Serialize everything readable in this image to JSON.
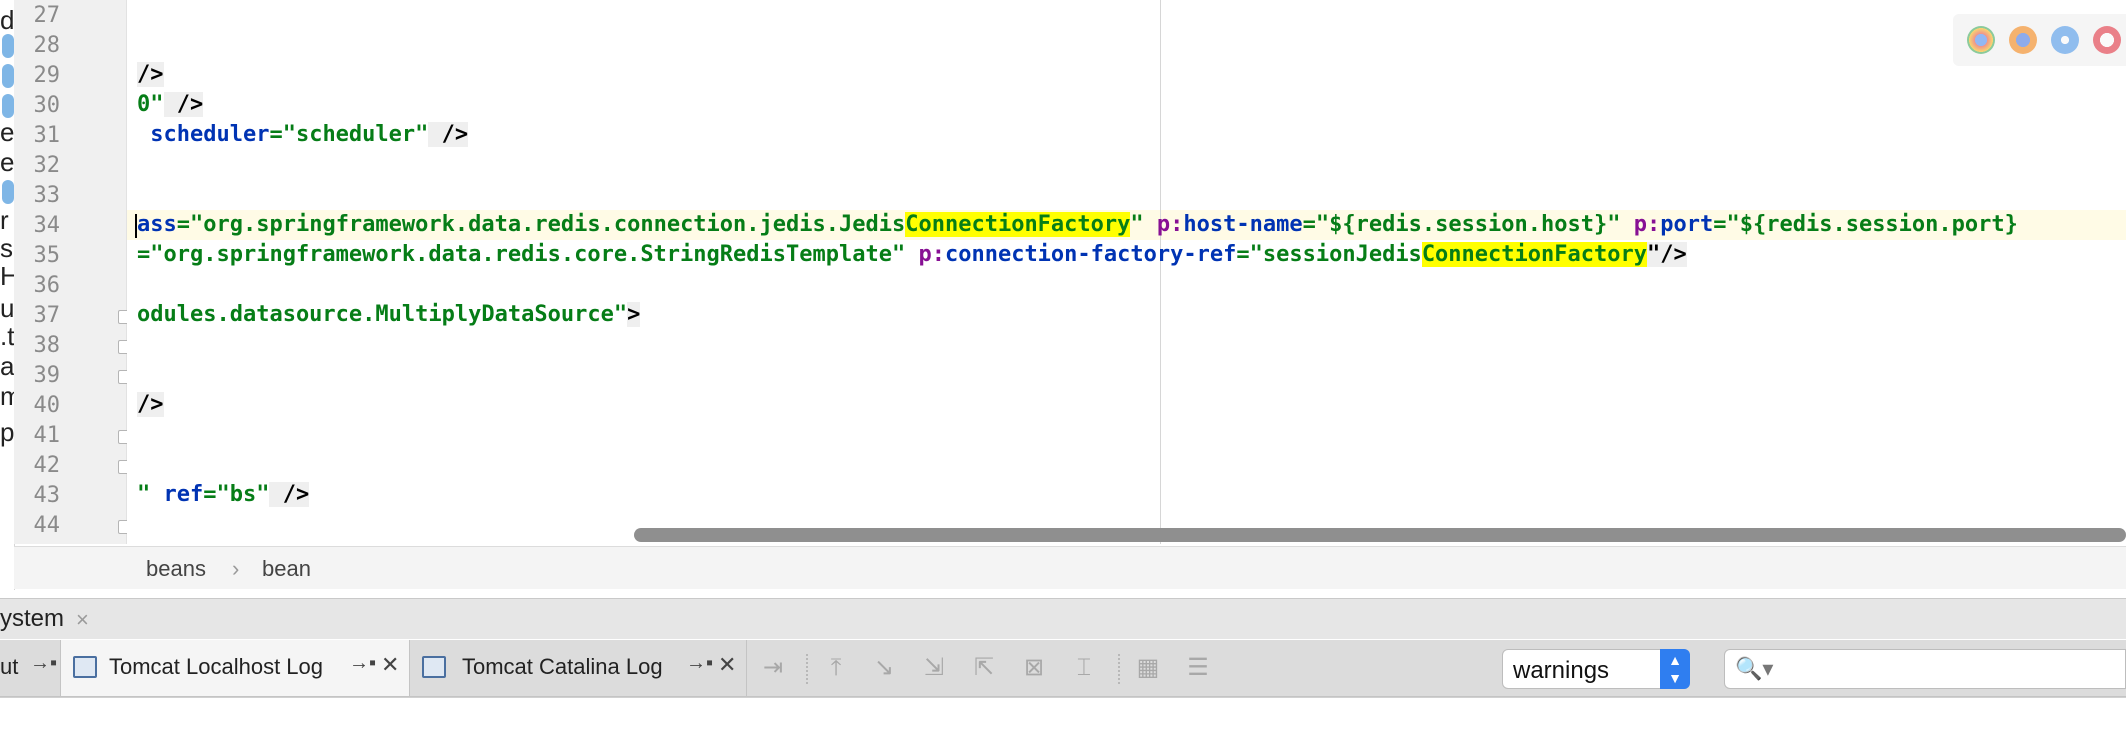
{
  "left_tree": {
    "stubs": [
      "d",
      "e",
      "e",
      "r",
      "s",
      "H",
      "ur",
      ".t",
      "at",
      "m",
      "p"
    ]
  },
  "editor": {
    "line_numbers": [
      "27",
      "28",
      "29",
      "30",
      "31",
      "32",
      "33",
      "34",
      "35",
      "36",
      "37",
      "38",
      "39",
      "40",
      "41",
      "42",
      "43",
      "44"
    ],
    "lines": {
      "l29": "/>",
      "l30_a": "0\"",
      "l30_b": " />",
      "l31_attr": " scheduler",
      "l31_eq": "=",
      "l31_val": "\"scheduler\"",
      "l31_end": " />",
      "l34_attr": "ass",
      "l34_val1": "=\"org.springframework.data.redis.connection.jedis.Jedis",
      "l34_hl": "ConnectionFactory",
      "l34_val1b": "\"",
      "l34_ns1": " p:",
      "l34_attr2": "host-name",
      "l34_val2": "=\"${redis.session.host}\"",
      "l34_ns2": " p:",
      "l34_attr3": "port",
      "l34_val3": "=\"${redis.session.port}",
      "l35_val1": "=\"org.springframework.data.redis.core.StringRedisTemplate\"",
      "l35_ns": " p:",
      "l35_attr": "connection-factory-ref",
      "l35_val2": "=\"sessionJedis",
      "l35_hl": "ConnectionFactory",
      "l35_end": "\"/>",
      "l37_val": "odules.datasource.MultiplyDataSource\"",
      "l37_end": ">",
      "l40": "/>",
      "l43_val": "\"",
      "l43_attr": " ref",
      "l43_val2": "=\"bs\"",
      "l43_end": " />"
    }
  },
  "breadcrumb": [
    "beans",
    "›",
    "bean"
  ],
  "tool_window": {
    "title": "ystem",
    "close": "×"
  },
  "tabs": [
    {
      "label": "ut",
      "pin": "→▪",
      "close": ""
    },
    {
      "label": "Tomcat Localhost Log",
      "pin": "→▪",
      "close": "✕"
    },
    {
      "label": "Tomcat Catalina Log",
      "pin": "→▪",
      "close": "✕"
    }
  ],
  "toolbar_icons": [
    "soft-wrap-icon",
    "scroll-to-top-icon",
    "scroll-to-end-icon",
    "download-icon",
    "upload-icon",
    "clear-all-icon",
    "cursor-icon",
    "print-icon",
    "settings-icon"
  ],
  "filter": {
    "value": "warnings",
    "arrows": "▲▼"
  },
  "search": {
    "icon": "🔍▾",
    "value": ""
  },
  "colors": {
    "accent": "#2f7ef0",
    "string": "#067d17",
    "attribute": "#0033b3",
    "namespace": "#871094",
    "highlight": "#ffff00"
  }
}
